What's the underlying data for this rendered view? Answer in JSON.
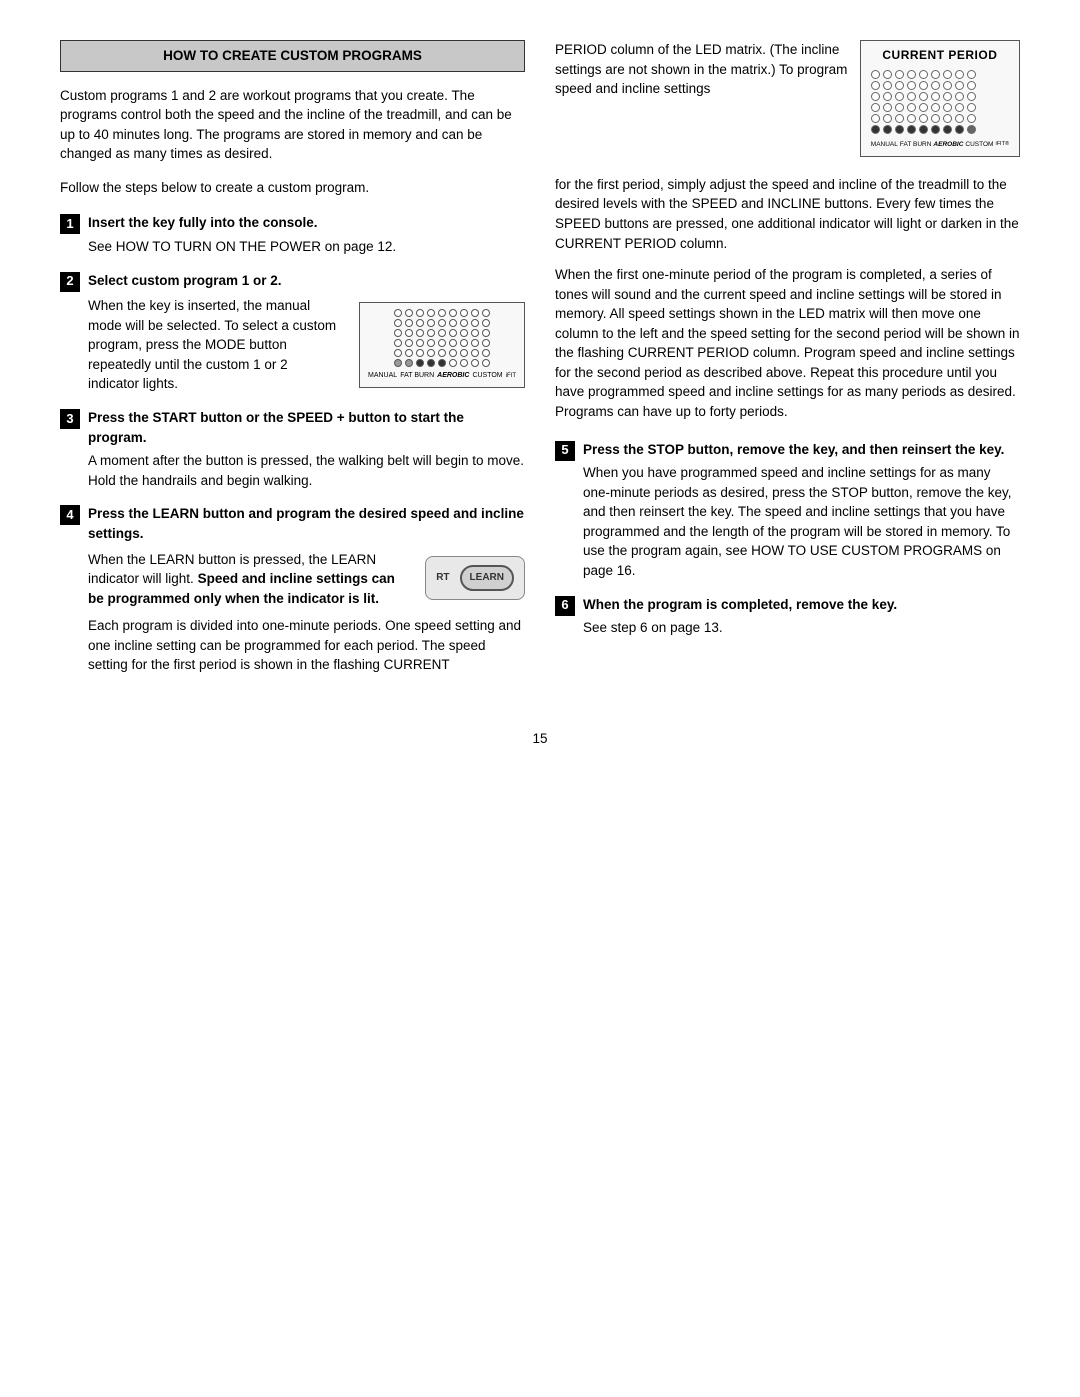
{
  "page": {
    "number": "15",
    "section_title": "HOW TO CREATE CUSTOM PROGRAMS",
    "intro": "Custom programs 1 and 2 are workout programs that you create. The programs control both the speed and the incline of the treadmill, and can be up to 40 minutes long. The programs are stored in memory and can be changed as many times as desired.",
    "follow_text": "Follow the steps below to create a custom program.",
    "steps": [
      {
        "number": "1",
        "title": "Insert the key fully into the console.",
        "body": "See HOW TO TURN ON THE POWER on page 12."
      },
      {
        "number": "2",
        "title": "Select custom program 1 or 2.",
        "body": "When the key is inserted, the manual mode will be selected. To select a custom program, press the MODE button repeatedly until the custom 1 or 2 indicator lights."
      },
      {
        "number": "3",
        "title": "Press the START button or the SPEED + button to start the program.",
        "body": "A moment after the button is pressed, the walking belt will begin to move. Hold the handrails and begin walking."
      },
      {
        "number": "4",
        "title": "Press the LEARN button and program the desired speed and incline settings.",
        "body_intro": "When the LEARN button is pressed, the LEARN indicator will light.",
        "body_bold": "Speed and incline settings can be programmed only when the indicator is lit.",
        "body_after": "Each program is divided into one-minute periods. One speed setting and one incline setting can be programmed for each period. The speed setting for the first period is shown in the flashing CURRENT"
      },
      {
        "number": "5",
        "title": "Press the STOP button, remove the key, and then reinsert the key.",
        "body": "When you have programmed speed and incline settings for as many one-minute periods as desired, press the STOP button, remove the key, and then reinsert the key. The speed and incline settings that you have programmed and the length of the program will be stored in memory. To use the program again, see HOW TO USE CUSTOM PROGRAMS on page 16."
      },
      {
        "number": "6",
        "title": "When the program is completed, remove the key.",
        "body": "See step 6 on page 13."
      }
    ],
    "right_col": {
      "period_intro": "PERIOD column of the LED matrix. (The incline settings are not shown in the matrix.) To program speed and incline settings",
      "period_body": "for the first period, simply adjust the speed and incline of the treadmill to the desired levels with the SPEED and INCLINE buttons. Every few times the SPEED buttons are pressed, one additional indicator will light or darken in the CURRENT PERIOD column.",
      "period_body2": "When the first one-minute period of the program is completed, a series of tones will sound and the current speed and incline settings will be stored in memory. All speed settings shown in the LED matrix will then move one column to the left and the speed setting for the second period will be shown in the flashing CURRENT PERIOD column. Program speed and incline settings for the second period as described above. Repeat this procedure until you have programmed speed and incline settings for as many periods as desired. Programs can have up to forty periods.",
      "current_period_label": "CURRENT PERIOD",
      "matrix_footer_labels": [
        "MANUAL",
        "FAT BURN",
        "AEROBIC",
        "CUSTOM",
        "iFIT"
      ]
    }
  }
}
